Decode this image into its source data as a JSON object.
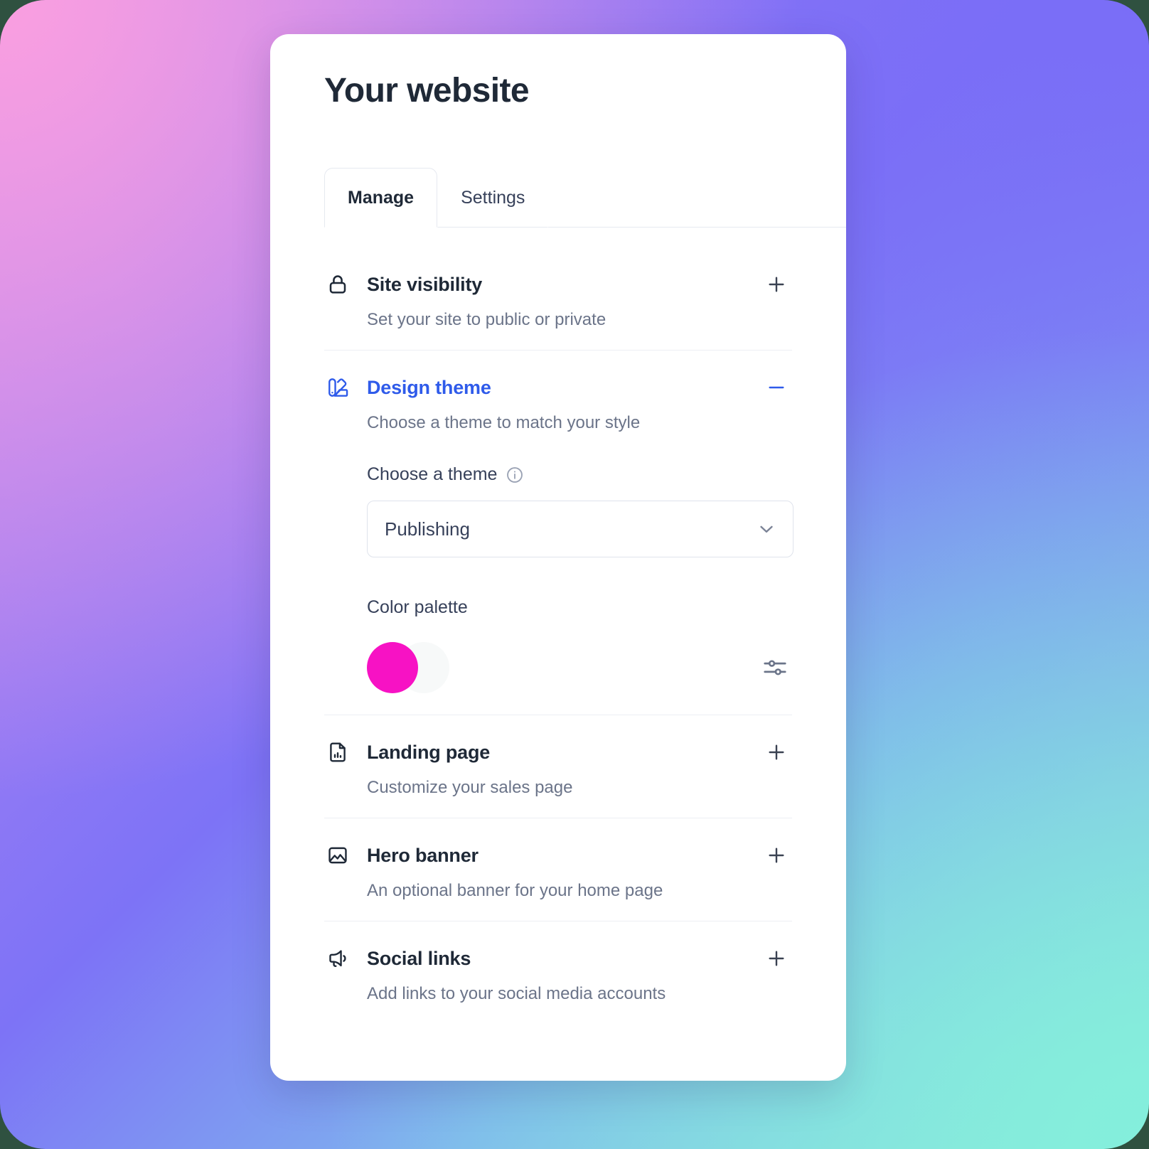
{
  "theme_colors": {
    "accent_blue": "#2f5bea",
    "title_dark": "#1f2937",
    "muted_text": "#6b7489",
    "swatch_primary": "#f712c4",
    "swatch_secondary": "#f7f9f9",
    "card_background": "#ffffff",
    "divider": "#edeff4"
  },
  "card": {
    "title": "Your website"
  },
  "tabs": [
    {
      "label": "Manage",
      "active": true
    },
    {
      "label": "Settings",
      "active": false
    }
  ],
  "sections": [
    {
      "title": "Site visibility",
      "description": "Set your site to public or private",
      "icon": "lock-icon",
      "expanded": false,
      "toggle": "plus-icon"
    },
    {
      "title": "Design theme",
      "description": "Choose a theme to match your style",
      "icon": "color-swatch-icon",
      "expanded": true,
      "toggle": "minus-icon",
      "body": {
        "theme_field_label": "Choose a theme",
        "theme_info_icon": "info-circle-icon",
        "theme_select_value": "Publishing",
        "theme_select_chevron": "chevron-down-icon",
        "palette_label": "Color palette",
        "palette_swatches": [
          "#f712c4",
          "#f7f9f9"
        ],
        "adjust_icon": "sliders-icon"
      }
    },
    {
      "title": "Landing page",
      "description": "Customize your sales page",
      "icon": "document-chart-icon",
      "expanded": false,
      "toggle": "plus-icon"
    },
    {
      "title": "Hero banner",
      "description": "An optional banner for your home page",
      "icon": "image-icon",
      "expanded": false,
      "toggle": "plus-icon"
    },
    {
      "title": "Social links",
      "description": "Add links to your social media accounts",
      "icon": "megaphone-icon",
      "expanded": false,
      "toggle": "plus-icon"
    }
  ]
}
